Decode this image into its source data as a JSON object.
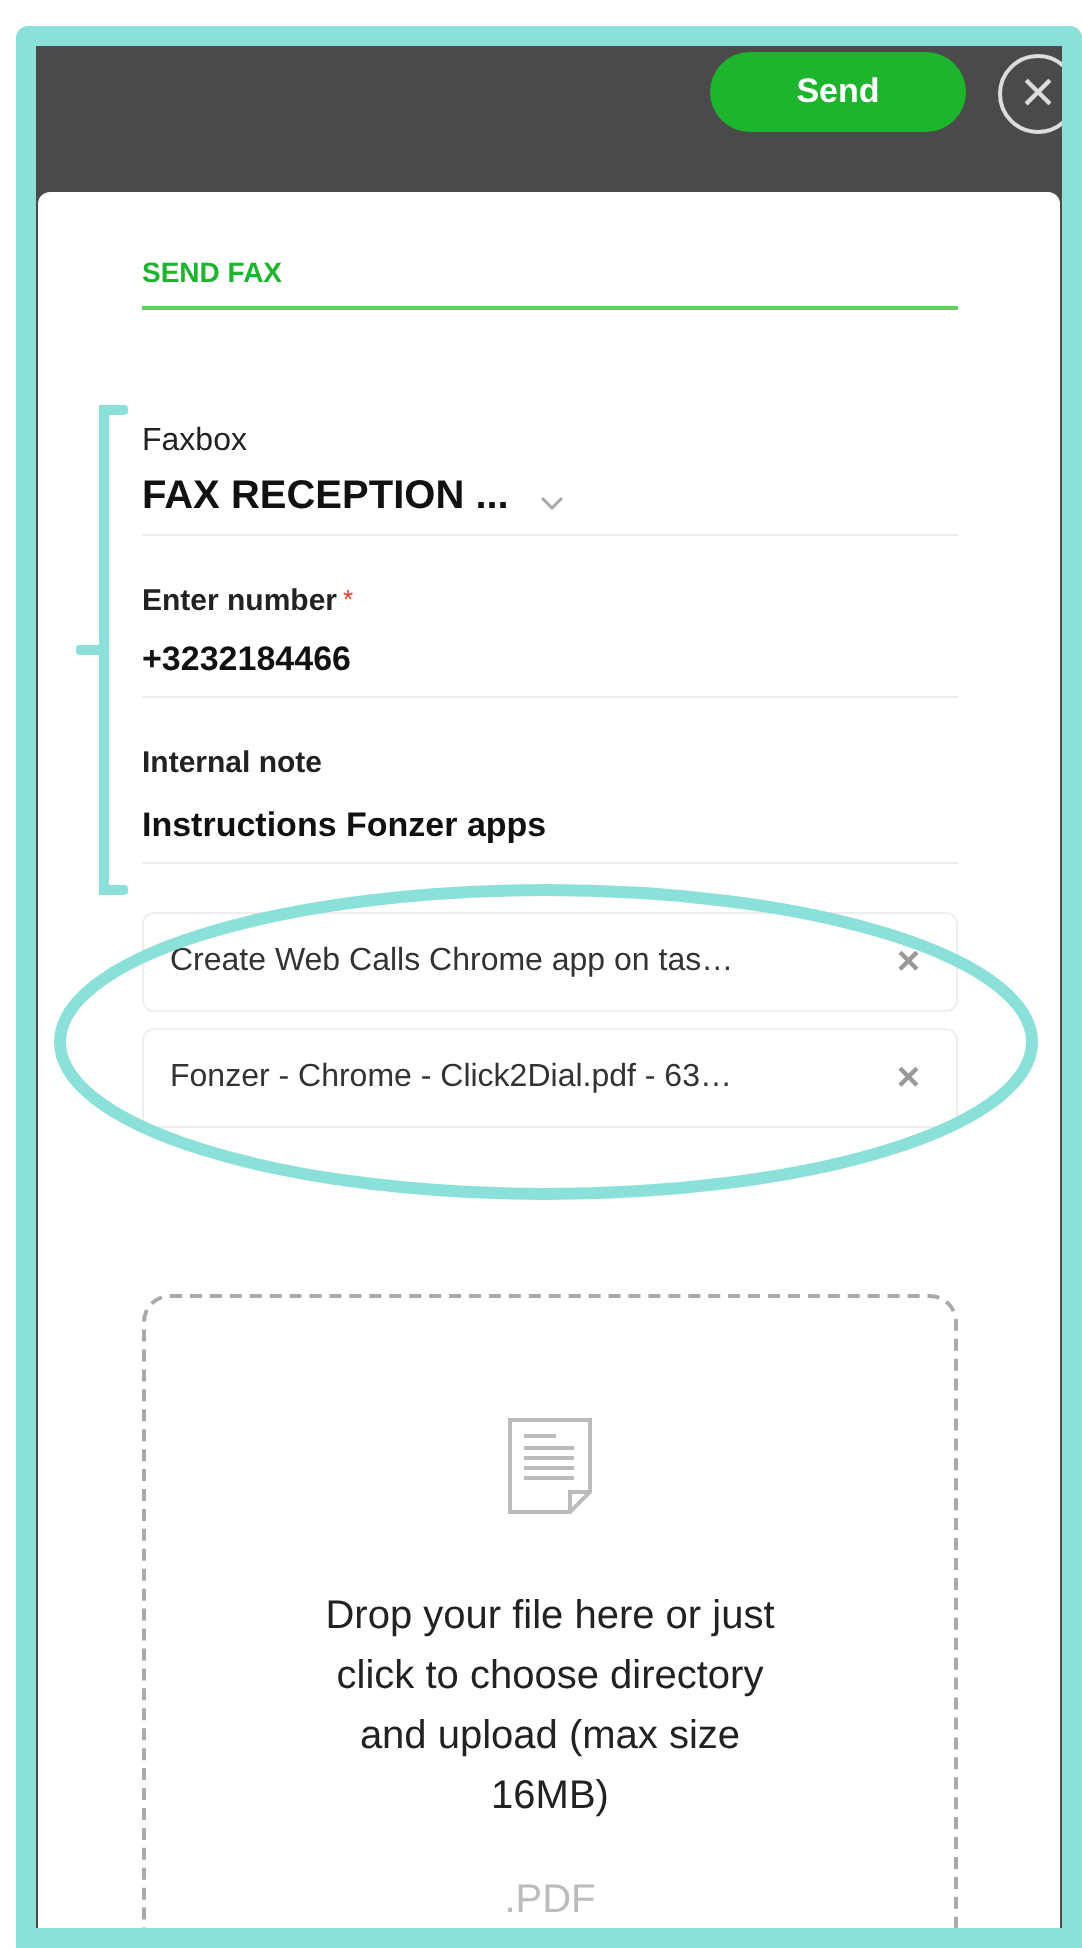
{
  "toolbar": {
    "send_button": "Send",
    "close_button": "×"
  },
  "form": {
    "title": "SEND FAX",
    "faxbox": {
      "label": "Faxbox",
      "value": "FAX RECEPTION ..."
    },
    "number": {
      "label": "Enter number",
      "required": true,
      "required_mark": "*",
      "value": "+3232184466"
    },
    "note": {
      "label": "Internal note",
      "value": "Instructions Fonzer apps"
    },
    "attachments": [
      {
        "name": "Create Web Calls Chrome app on tas…",
        "remove": "×"
      },
      {
        "name": "Fonzer - Chrome - Click2Dial.pdf - 63…",
        "remove": "×"
      }
    ],
    "dropzone": {
      "text": "Drop your file here or just click to choose directory and upload (max size 16MB)",
      "formats": ".PDF"
    }
  }
}
